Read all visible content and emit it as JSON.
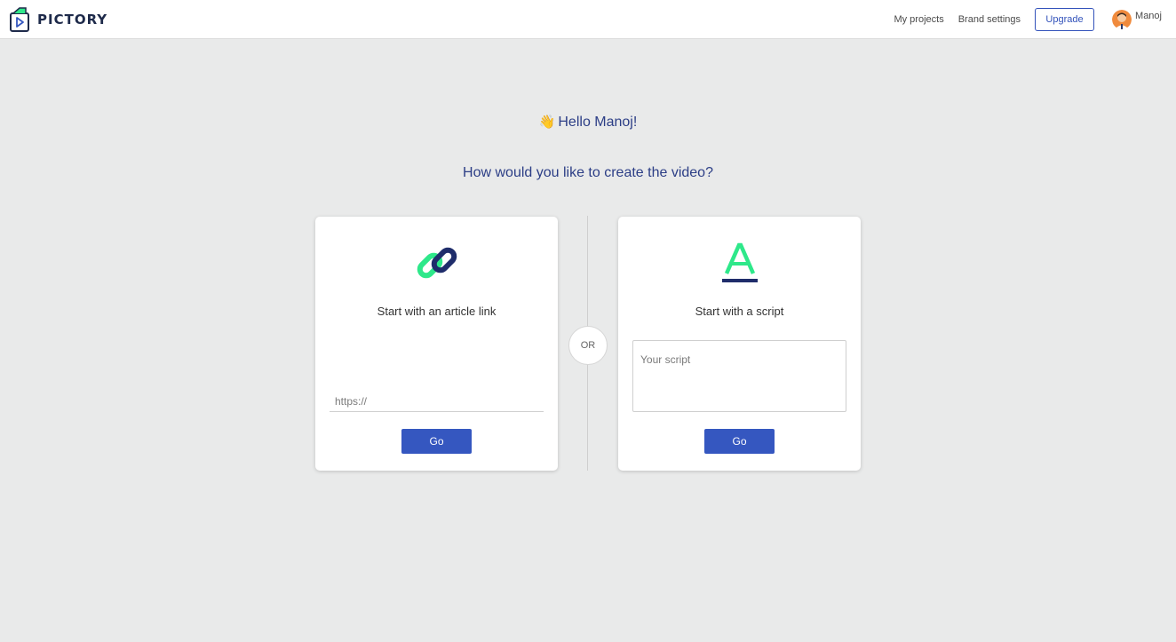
{
  "brand": {
    "name": "PICTORY"
  },
  "nav": {
    "my_projects": "My projects",
    "brand_settings": "Brand settings",
    "upgrade": "Upgrade",
    "user_name": "Manoj"
  },
  "greeting": {
    "emoji": "👋",
    "text": "Hello Manoj!"
  },
  "question": "How would you like to create the video?",
  "article_card": {
    "icon": "link-icon",
    "title": "Start with an article link",
    "input_placeholder": "https://",
    "button": "Go"
  },
  "or_label": "OR",
  "script_card": {
    "icon": "text-a-icon",
    "title": "Start with a script",
    "input_placeholder": "Your script",
    "button": "Go"
  },
  "colors": {
    "accent": "#3557c0",
    "heading": "#2c3e86",
    "icon_green": "#2ee88a",
    "icon_navy": "#1f2d6b",
    "background": "#e9eaea"
  }
}
